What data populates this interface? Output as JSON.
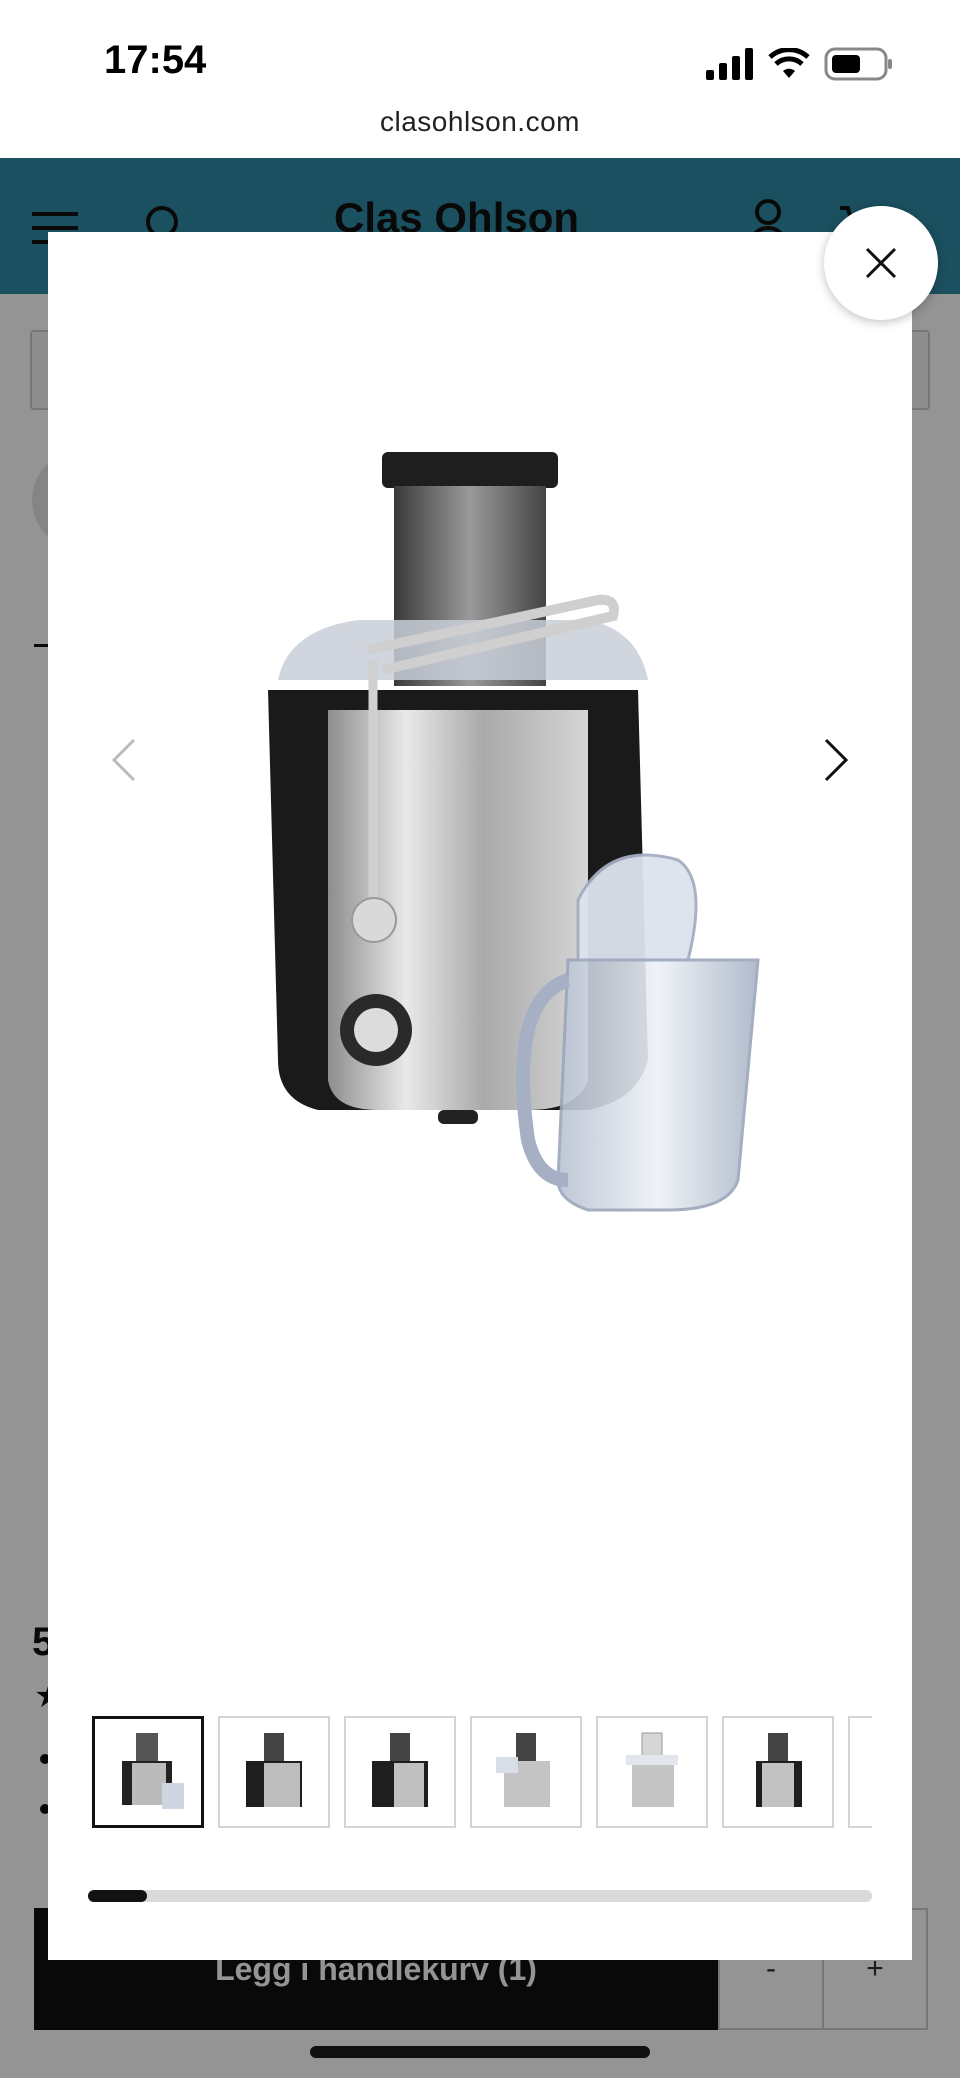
{
  "status_bar": {
    "time": "17:54",
    "icons": [
      "signal-icon",
      "wifi-icon",
      "battery-icon"
    ]
  },
  "browser": {
    "url": "clasohlson.com"
  },
  "header": {
    "logo_text": "Clas Ohlson",
    "brand_color": "#2f8aa6",
    "icons": [
      "menu-icon",
      "search-icon",
      "account-icon",
      "cart-icon"
    ]
  },
  "background_page": {
    "rating_digit": "5",
    "add_to_cart_label": "Legg i handlekurv (1)",
    "qty_minus": "-",
    "qty_plus": "+"
  },
  "gallery": {
    "image_name": "juicer-product-image",
    "thumbnail_count_visible": 7,
    "active_thumbnail_index": 0,
    "scroll_progress": 0.075
  }
}
